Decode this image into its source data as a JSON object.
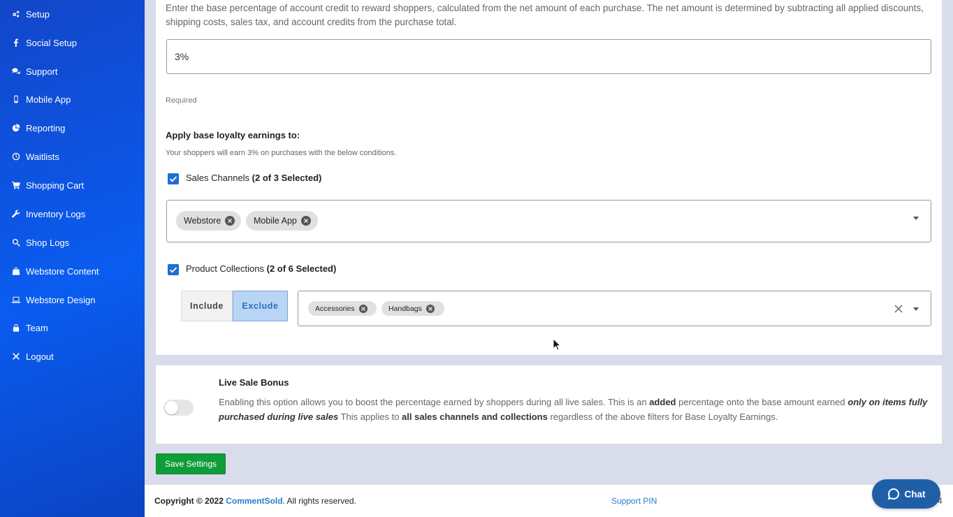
{
  "sidebar": {
    "items": [
      {
        "label": "Setup",
        "icon": "gears-icon"
      },
      {
        "label": "Social Setup",
        "icon": "facebook-icon"
      },
      {
        "label": "Support",
        "icon": "comments-icon"
      },
      {
        "label": "Mobile App",
        "icon": "mobile-icon"
      },
      {
        "label": "Reporting",
        "icon": "pie-chart-icon"
      },
      {
        "label": "Waitlists",
        "icon": "clock-icon"
      },
      {
        "label": "Shopping Cart",
        "icon": "cart-icon"
      },
      {
        "label": "Inventory Logs",
        "icon": "wrench-icon"
      },
      {
        "label": "Shop Logs",
        "icon": "search-icon"
      },
      {
        "label": "Webstore Content",
        "icon": "shopping-bag-icon"
      },
      {
        "label": "Webstore Design",
        "icon": "laptop-icon"
      },
      {
        "label": "Team",
        "icon": "lock-icon"
      },
      {
        "label": "Logout",
        "icon": "close-icon"
      }
    ]
  },
  "base_loyalty": {
    "description": "Enter the base percentage of account credit to reward shoppers, calculated from the net amount of each purchase. The net amount is determined by subtracting all applied discounts, shipping costs, sales tax, and account credits from the purchase total.",
    "percentage_value": "3%",
    "required_label": "Required",
    "apply_title": "Apply base loyalty earnings to:",
    "apply_subtitle": "Your shoppers will earn 3% on purchases with the below conditions.",
    "sales_channels": {
      "label": "Sales Channels ",
      "count": "(2 of 3 Selected)",
      "checked": true,
      "chips": [
        "Webstore",
        "Mobile App"
      ]
    },
    "product_collections": {
      "label": "Product Collections ",
      "count": "(2 of 6 Selected)",
      "checked": true,
      "include_label": "Include",
      "exclude_label": "Exclude",
      "selected_mode": "Exclude",
      "chips": [
        "Accessories",
        "Handbags"
      ]
    }
  },
  "live_sale": {
    "title": "Live Sale Bonus",
    "enabled": false,
    "desc_1": "Enabling this option allows you to boost the percentage earned by shoppers during all live sales. This is an ",
    "desc_b1": "added",
    "desc_2": " percentage onto the base amount earned ",
    "desc_bi": "only on items fully purchased during live sales",
    "desc_3": " This applies to ",
    "desc_b2": "all sales channels and collections",
    "desc_4": " regardless of the above filters for Base Loyalty Earnings."
  },
  "save_label": "Save Settings",
  "footer": {
    "copyright_prefix": "Copyright © 2022 ",
    "brand": "CommentSold",
    "copyright_suffix": ". All rights reserved.",
    "support_pin": "Support PIN",
    "version_fragment": "4"
  },
  "chat": {
    "label": "Chat"
  },
  "colors": {
    "sidebar_blue": "#0a5cf0",
    "checkbox_blue": "#1f6fd1",
    "save_green": "#0f9d3a",
    "chat_blue": "#1f5fa8",
    "link_blue": "#2a7bd1"
  }
}
